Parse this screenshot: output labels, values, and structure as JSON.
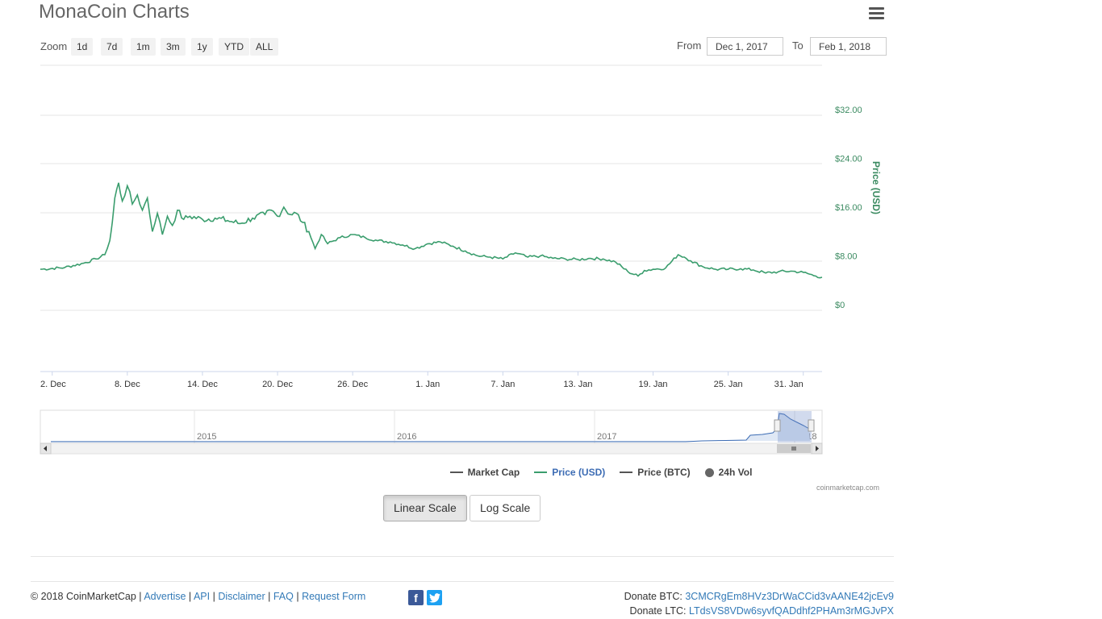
{
  "page": {
    "title": "MonaCoin Charts"
  },
  "zoom": {
    "label": "Zoom",
    "buttons": [
      "1d",
      "7d",
      "1m",
      "3m",
      "1y",
      "YTD",
      "ALL"
    ]
  },
  "range": {
    "from_label": "From",
    "from_value": "Dec 1, 2017",
    "to_label": "To",
    "to_value": "Feb 1, 2018"
  },
  "chart_data": {
    "type": "line",
    "ylabel": "Price (USD)",
    "y_ticks": [
      "$0",
      "$8.00",
      "$16.00",
      "$24.00",
      "$32.00"
    ],
    "ylim": [
      0,
      40
    ],
    "x_ticks": [
      "2. Dec",
      "8. Dec",
      "14. Dec",
      "20. Dec",
      "26. Dec",
      "1. Jan",
      "7. Jan",
      "13. Jan",
      "19. Jan",
      "25. Jan",
      "31. Jan"
    ],
    "x_tick_days": [
      1,
      7,
      13,
      19,
      25,
      31,
      37,
      43,
      49,
      55,
      61
    ],
    "x_range_days": [
      0.05,
      62.5
    ],
    "grid": true,
    "series": [
      {
        "name": "Price (USD)",
        "color": "#3a9d6d",
        "x": [
          0.05,
          2,
          3.5,
          4.5,
          5.2,
          5.6,
          5.8,
          6.0,
          6.3,
          6.6,
          7.0,
          7.4,
          7.8,
          8.2,
          8.6,
          9.0,
          9.4,
          9.8,
          10.2,
          10.6,
          11.0,
          11.5,
          12.0,
          13,
          14,
          15,
          16,
          17,
          18,
          18.5,
          19,
          19.5,
          20,
          20.5,
          21,
          21.5,
          22.0,
          22.5,
          23,
          24,
          25,
          26,
          27,
          28,
          29,
          30,
          31,
          32,
          33,
          34,
          35,
          36,
          37,
          38,
          39,
          40,
          41,
          42,
          43,
          44,
          45,
          46,
          47,
          47.8,
          48.3,
          49,
          50,
          51,
          51.5,
          52,
          53,
          54,
          55,
          56,
          57,
          58,
          59,
          60,
          61,
          62,
          62.5
        ],
        "y": [
          5.8,
          6.1,
          6.8,
          7.5,
          8.2,
          10.5,
          13.5,
          17.5,
          20.0,
          17.0,
          19.5,
          16.5,
          18.0,
          15.5,
          17.5,
          12.0,
          15.0,
          11.5,
          14.5,
          13.0,
          15.5,
          14.0,
          14.5,
          14.0,
          14.2,
          13.8,
          13.3,
          14.2,
          14.8,
          15.5,
          14.5,
          16.0,
          14.8,
          15.0,
          13.5,
          12.0,
          9.2,
          11.5,
          10.0,
          11.0,
          11.5,
          11.0,
          10.5,
          10.3,
          9.8,
          9.2,
          10.0,
          10.3,
          9.6,
          8.8,
          8.0,
          7.8,
          7.5,
          8.5,
          7.8,
          8.0,
          7.6,
          7.5,
          7.4,
          7.6,
          7.5,
          7.0,
          5.4,
          4.7,
          5.6,
          5.8,
          6.0,
          8.2,
          7.8,
          7.2,
          6.2,
          5.8,
          5.8,
          5.9,
          5.7,
          5.2,
          5.4,
          5.5,
          5.3,
          4.7,
          4.5
        ]
      }
    ]
  },
  "navigator": {
    "years": [
      "2015",
      "2016",
      "2017",
      "2018"
    ]
  },
  "legend": {
    "items": [
      {
        "label": "Market Cap",
        "color": "#555555"
      },
      {
        "label": "Price (USD)",
        "color": "#3a9d6d",
        "active": true
      },
      {
        "label": "Price (BTC)",
        "color": "#555555"
      },
      {
        "label": "24h Vol",
        "color": "#666666"
      }
    ]
  },
  "credit": "coinmarketcap.com",
  "scale_buttons": {
    "linear": "Linear Scale",
    "log": "Log Scale"
  },
  "footer": {
    "copyright": "© 2018 CoinMarketCap",
    "links": [
      "Advertise",
      "API",
      "Disclaimer",
      "FAQ",
      "Request Form"
    ],
    "donate_btc_label": "Donate BTC:",
    "donate_btc": "3CMCRgEm8HVz3DrWaCCid3vAANE42jcEv9",
    "donate_ltc_label": "Donate LTC:",
    "donate_ltc": "LTdsVS8VDw6syvfQADdhf2PHAm3rMGJvPX"
  }
}
